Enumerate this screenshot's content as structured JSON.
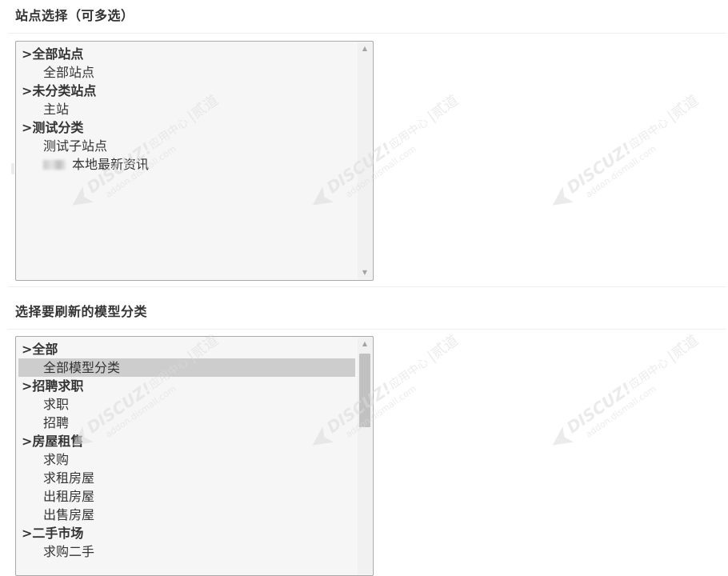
{
  "site_section": {
    "title": "站点选择（可多选）",
    "options": [
      {
        "label": ">全部站点",
        "kind": "group"
      },
      {
        "label": "全部站点",
        "kind": "child"
      },
      {
        "label": ">未分类站点",
        "kind": "group"
      },
      {
        "label": "主站",
        "kind": "child"
      },
      {
        "label": ">测试分类",
        "kind": "group"
      },
      {
        "label": "测试子站点",
        "kind": "child"
      },
      {
        "label": "本地最新资讯",
        "kind": "child",
        "blurred_prefix": true
      }
    ]
  },
  "model_section": {
    "title": "选择要刷新的模型分类",
    "options": [
      {
        "label": ">全部",
        "kind": "group"
      },
      {
        "label": "全部模型分类",
        "kind": "child",
        "selected": true
      },
      {
        "label": ">招聘求职",
        "kind": "group"
      },
      {
        "label": "求职",
        "kind": "child"
      },
      {
        "label": "招聘",
        "kind": "child"
      },
      {
        "label": ">房屋租售",
        "kind": "group"
      },
      {
        "label": "求购",
        "kind": "child"
      },
      {
        "label": "求租房屋",
        "kind": "child"
      },
      {
        "label": "出租房屋",
        "kind": "child"
      },
      {
        "label": "出售房屋",
        "kind": "child"
      },
      {
        "label": ">二手市场",
        "kind": "group"
      },
      {
        "label": "求购二手",
        "kind": "child"
      }
    ]
  },
  "watermark": {
    "brand": "DISCUZ!",
    "cn": "应用中心",
    "domain": "addon.dismall.com",
    "mark": "贰道",
    "color": "#dcdcdc"
  }
}
